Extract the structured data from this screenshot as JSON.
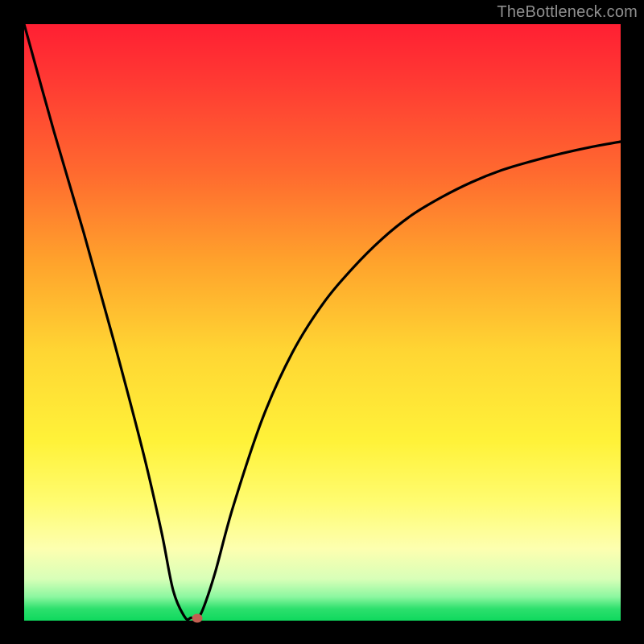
{
  "watermark": "TheBottleneck.com",
  "colors": {
    "background": "#000000",
    "curve": "#000000",
    "marker": "#c35f51",
    "gradient_top": "#ff1f33",
    "gradient_bottom": "#0fd95e"
  },
  "chart_data": {
    "type": "line",
    "title": "",
    "xlabel": "",
    "ylabel": "",
    "xlim": [
      0,
      100
    ],
    "ylim": [
      0,
      100
    ],
    "grid": false,
    "legend": false,
    "series": [
      {
        "name": "bottleneck-curve",
        "x": [
          0,
          5,
          10,
          15,
          20,
          23,
          25,
          27,
          28,
          29,
          30,
          32,
          35,
          40,
          45,
          50,
          55,
          60,
          65,
          70,
          75,
          80,
          85,
          90,
          95,
          100
        ],
        "y": [
          100,
          82,
          65,
          47,
          28,
          15,
          5,
          0.5,
          0.5,
          0.4,
          2,
          8,
          19,
          34,
          45,
          53,
          59,
          64,
          68,
          71,
          73.5,
          75.5,
          77,
          78.3,
          79.4,
          80.3
        ]
      }
    ],
    "marker": {
      "x": 29,
      "y": 0.4
    }
  }
}
